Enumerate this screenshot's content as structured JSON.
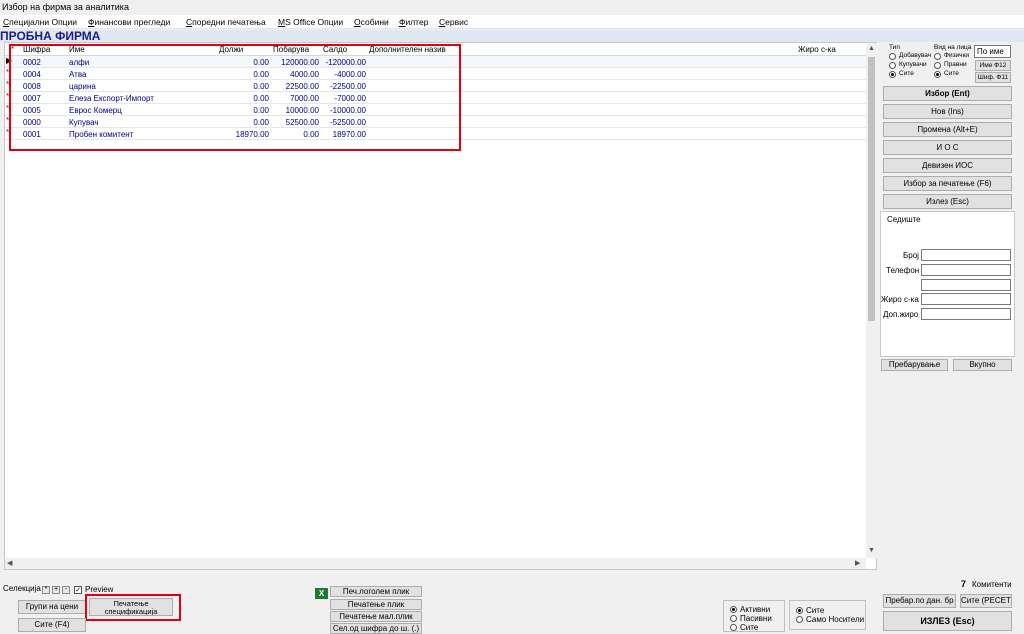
{
  "window": {
    "title": "Избор на фирма за аналитика"
  },
  "menu": [
    "Специјални Опции",
    "Финансови прегледи",
    "Споредни печатења",
    "MS Office Опции",
    "Особини",
    "Филтер",
    "Сервис"
  ],
  "firm_name": "ПРОБНА ФИРМА",
  "grid": {
    "headers": {
      "code": "Шифра",
      "name": "Име",
      "debit": "Должи",
      "credit": "Побарува",
      "balance": "Салдо",
      "extra": "Дополнителен назив",
      "account": "Жиро с-ка"
    },
    "rows": [
      {
        "marker": "▶",
        "code": "0002",
        "name": "алфи",
        "debit": "0.00",
        "credit": "120000.00",
        "balance": "-120000.00"
      },
      {
        "marker": "*",
        "code": "0004",
        "name": "Атва",
        "debit": "0.00",
        "credit": "4000.00",
        "balance": "-4000.00"
      },
      {
        "marker": "*",
        "code": "0008",
        "name": "царина",
        "debit": "0.00",
        "credit": "22500.00",
        "balance": "-22500.00"
      },
      {
        "marker": "*",
        "code": "0007",
        "name": "Елеза Експорт-Импорт",
        "debit": "0.00",
        "credit": "7000.00",
        "balance": "-7000.00"
      },
      {
        "marker": "*",
        "code": "0005",
        "name": "Еврос Комерц",
        "debit": "0.00",
        "credit": "10000.00",
        "balance": "-10000.00"
      },
      {
        "marker": "*",
        "code": "0000",
        "name": "Купувач",
        "debit": "0.00",
        "credit": "52500.00",
        "balance": "-52500.00"
      },
      {
        "marker": "*",
        "code": "0001",
        "name": "Пробен комитент",
        "debit": "18970.00",
        "credit": "0.00",
        "balance": "18970.00"
      }
    ]
  },
  "right_panel": {
    "type_label": "Тип",
    "type_options": [
      "Добавувач",
      "Купувачи",
      "Сите"
    ],
    "person_label": "Вид на лица",
    "person_options": [
      "Физички",
      "Правни",
      "Сите"
    ],
    "by_name": "По име",
    "name_f12": "Име Ф12",
    "code_f11": "Шиф. Ф11",
    "buttons": [
      "Избор (Ent)",
      "Нов (Ins)",
      "Промена (Alt+E)",
      "И О С",
      "Девизен ИОС",
      "Избор за печатење (F6)",
      "Излез (Esc)"
    ],
    "seat_label": "Седиште",
    "number_label": "Број",
    "phone_label": "Телефон",
    "account_label": "Жиро с-ка",
    "extra_account_label": "Доп.жиро",
    "search_button": "Пребарување",
    "total_button": "Вкупно"
  },
  "bottom": {
    "selection_label": "Селекција",
    "sel_star": "*",
    "sel_plus": "+",
    "sel_minus": "-",
    "preview_label": "Preview",
    "price_groups": "Групи на цени",
    "print_spec": "Печатење спецификација",
    "all_f4": "Сите (F4)",
    "print_large_env": "Печ.логолем плик",
    "print_env": "Печатење плик",
    "print_small_env": "Печатење мал.плик",
    "sel_code_range": "Сел.од шифра до ш. (.)",
    "status_options": [
      "Активни",
      "Пасивни",
      "Сите"
    ],
    "carrier_options": [
      "Сите",
      "Само Носители"
    ],
    "count": "7",
    "count_label": "Комитенти",
    "search_tax": "Пребар.по дан. бр",
    "all_reset": "Сите (РЕСЕТ)",
    "exit_big": "ИЗЛЕЗ   (Esc)"
  }
}
